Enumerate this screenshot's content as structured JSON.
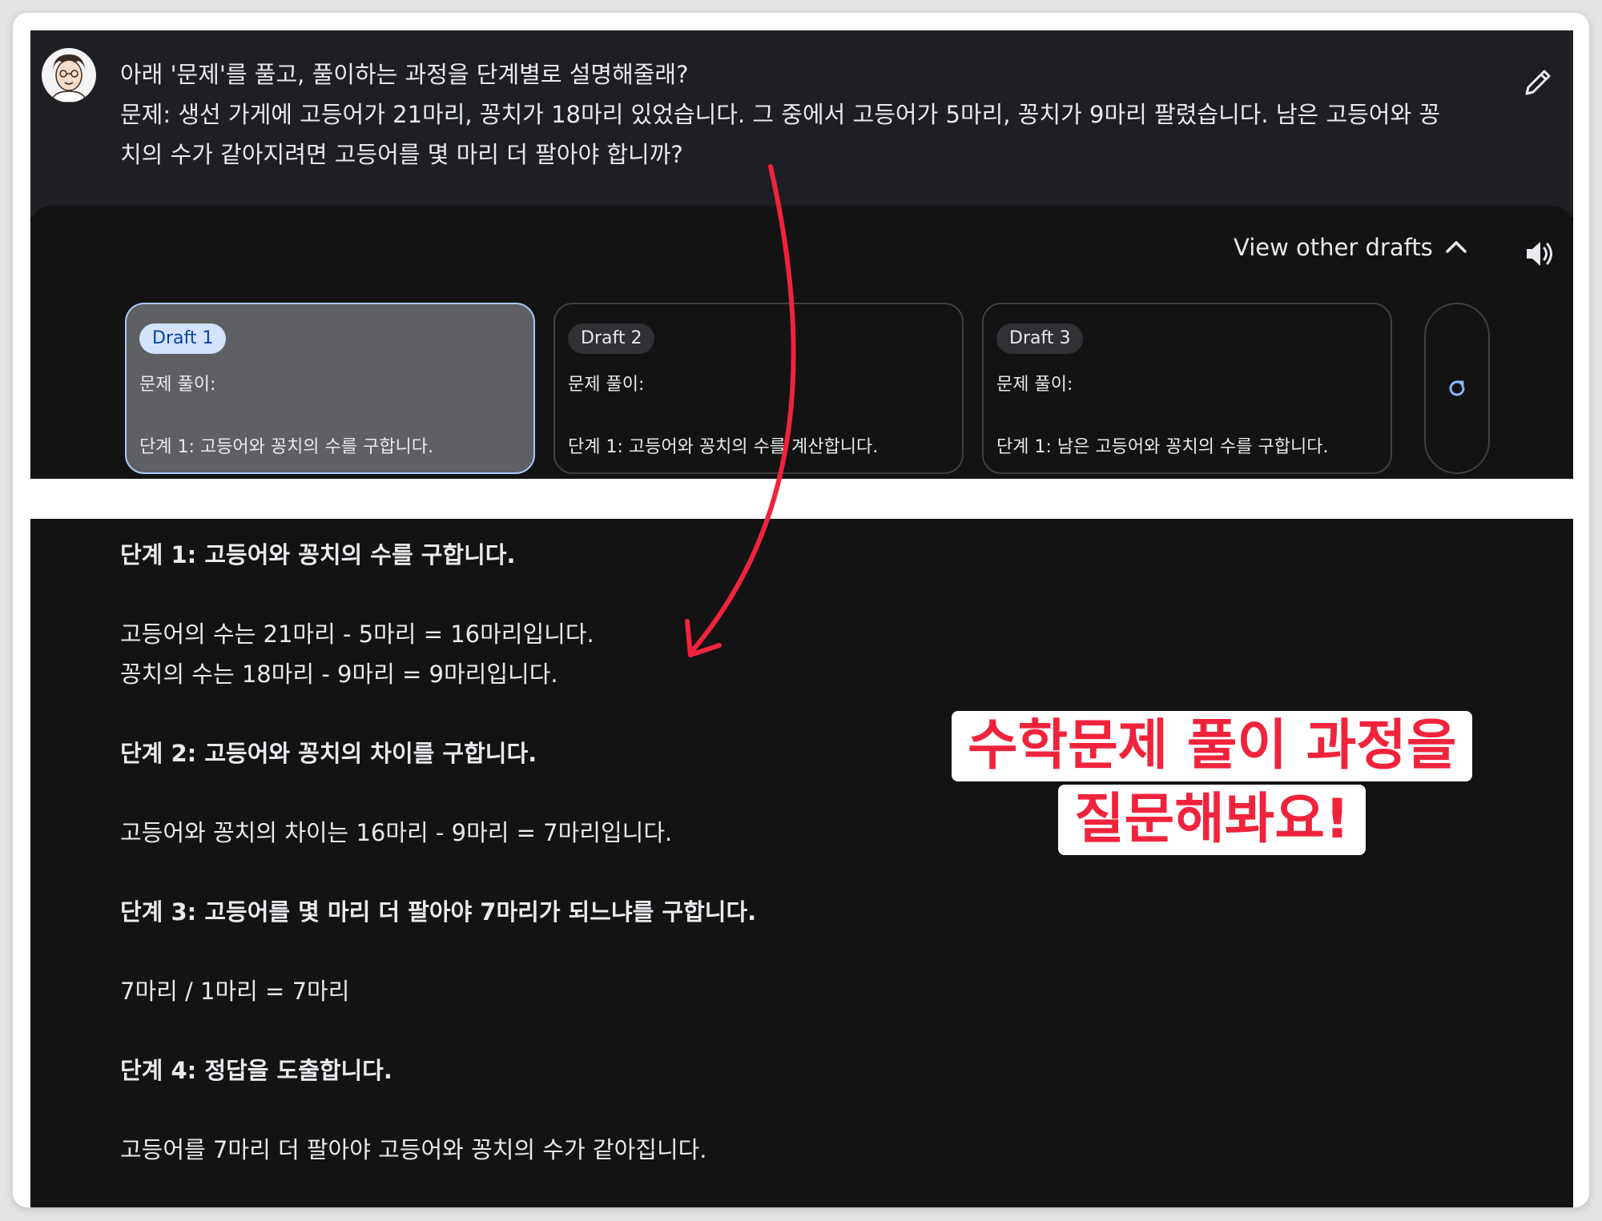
{
  "prompt": {
    "lines": [
      "아래 '문제'를 풀고, 풀이하는 과정을 단계별로 설명해줄래?",
      "문제: 생선 가게에 고등어가 21마리, 꽁치가 18마리 있었습니다. 그 중에서 고등어가 5마리, 꽁치가 9마리 팔렸습니다. 남은 고등어와 꽁",
      "치의 수가 같아지려면 고등어를 몇 마리 더 팔아야 합니까?"
    ],
    "edit_icon": "pencil-icon"
  },
  "drafts_header": {
    "view_label": "View other drafts",
    "chevron_icon": "chevron-up-icon",
    "speaker_icon": "speaker-icon"
  },
  "drafts": [
    {
      "chip": "Draft 1",
      "line1": "문제 풀이:",
      "line2": "단계 1: 고등어와 꽁치의 수를 구합니다.",
      "selected": true
    },
    {
      "chip": "Draft 2",
      "line1": "문제 풀이:",
      "line2": "단계 1: 고등어와 꽁치의 수를 계산합니다.",
      "selected": false
    },
    {
      "chip": "Draft 3",
      "line1": "문제 풀이:",
      "line2": "단계 1: 남은 고등어와 꽁치의 수를 구합니다.",
      "selected": false
    }
  ],
  "regenerate_icon": "refresh-icon",
  "answer": {
    "step1": "단계 1: 고등어와 꽁치의 수를 구합니다.",
    "line1": "고등어의 수는 21마리 - 5마리 = 16마리입니다.",
    "line2": "꽁치의 수는 18마리 - 9마리 = 9마리입니다.",
    "step2": "단계 2: 고등어와 꽁치의 차이를 구합니다.",
    "line3": "고등어와 꽁치의 차이는 16마리 - 9마리 = 7마리입니다.",
    "step3": "단계 3: 고등어를 몇 마리 더 팔아야 7마리가 되느냐를 구합니다.",
    "line4": "7마리 / 1마리 = 7마리",
    "step4": "단계 4: 정답을 도출합니다.",
    "line5": "고등어를 7마리 더 팔아야 고등어와 꽁치의 수가 같아집니다."
  },
  "callout": {
    "line1": "수학문제 풀이 과정을",
    "line2": "질문해봐요!"
  },
  "colors": {
    "accent_red": "#f0233c",
    "selected_chip": "#d3e3fd",
    "selected_border": "#a8c7fa",
    "regen_blue": "#8ab4f8"
  }
}
